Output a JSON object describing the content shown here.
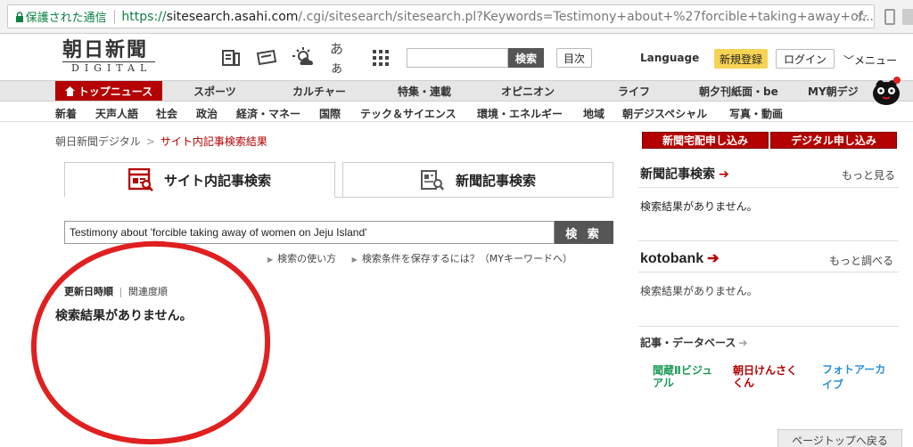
{
  "browser": {
    "secure_label": "保護された通信",
    "url_scheme": "https://",
    "url_host": "sitesearch.asahi.com",
    "url_path": "/.cgi/sitesearch/sitesearch.pl?Keywords=Testimony+about+%27forcible+taking+away+of..."
  },
  "header": {
    "logo_main": "朝日新聞",
    "logo_sub": "DIGITAL",
    "icons": [
      "newspaper-icon",
      "coupon-icon",
      "weather-icon",
      "font-size-icon",
      "grid-icon"
    ],
    "font_icon_text": "あぁ",
    "search_button": "検索",
    "index_button": "目次",
    "language": "Language",
    "register": "新規登録",
    "login": "ログイン",
    "menu": "メニュー"
  },
  "nav": {
    "items": [
      "トップニュース",
      "スポーツ",
      "カルチャー",
      "特集・連載",
      "オピニオン",
      "ライフ",
      "朝夕刊紙面・be",
      "MY朝デジ"
    ]
  },
  "subnav": {
    "items": [
      "新着",
      "天声人語",
      "社会",
      "政治",
      "経済・マネー",
      "国際",
      "テック＆サイエンス",
      "環境・エネルギー",
      "地域",
      "朝デジスペシャル",
      "写真・動画"
    ]
  },
  "breadcrumb": {
    "home": "朝日新聞デジタル",
    "separator": ">",
    "current": "サイト内記事検索結果"
  },
  "tabs": [
    {
      "label": "サイト内記事検索",
      "active": true
    },
    {
      "label": "新聞記事検索",
      "active": false
    }
  ],
  "search": {
    "value": "Testimony about 'forcible taking away of women on Jeju Island'",
    "button": "検 索",
    "help_usage": "検索の使い方",
    "help_save": "検索条件を保存するには？（MYキーワードへ）"
  },
  "sort": {
    "active": "更新日時順",
    "other": "関連度順"
  },
  "results": {
    "no_result": "検索結果がありません。"
  },
  "right": {
    "btn_delivery": "新聞宅配申し込み",
    "btn_digital": "デジタル申し込み",
    "paper_head": "新聞記事検索",
    "paper_more": "もっと見る",
    "paper_result": "検索結果がありません。",
    "kotobank_head": "kotobank",
    "kotobank_more": "もっと調べる",
    "kotobank_result": "検索結果がありません。",
    "db_head": "記事・データベース",
    "db_logos": [
      "聞蔵Ⅱビジュアル",
      "朝日けんさくくん",
      "フォトアーカイブ"
    ],
    "page_top": "ページトップへ戻る"
  },
  "colors": {
    "accent_red": "#b40000",
    "secure_green": "#0b8043",
    "register_yellow": "#f6d353",
    "annotation_red": "#e02020"
  }
}
